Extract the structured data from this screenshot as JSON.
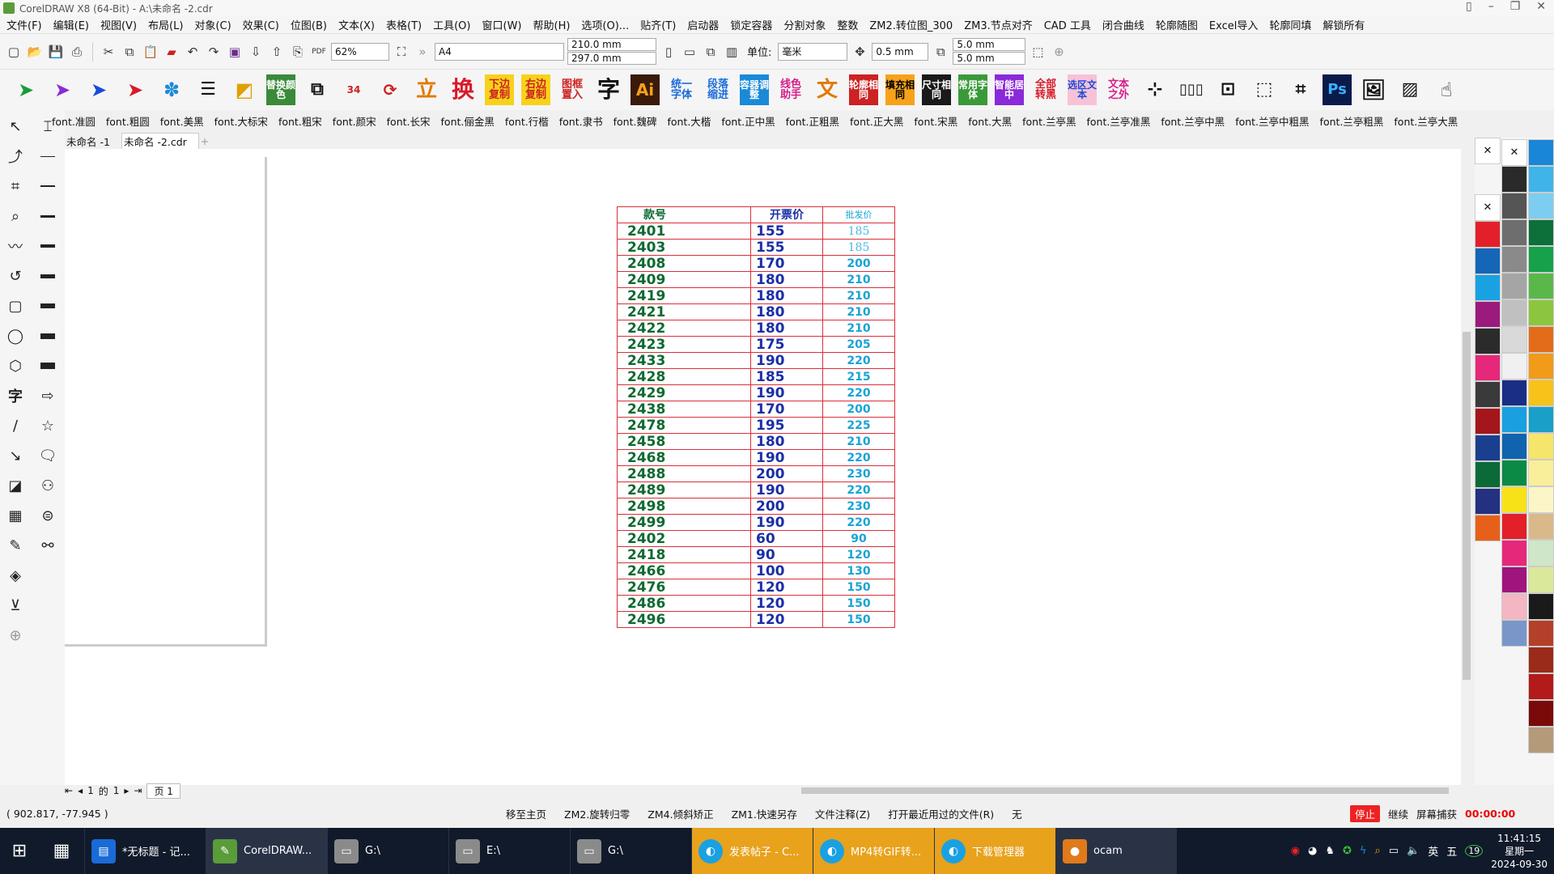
{
  "window": {
    "title": "CorelDRAW X8 (64-Bit) - A:\\未命名 -2.cdr"
  },
  "menu": [
    "文件(F)",
    "编辑(E)",
    "视图(V)",
    "布局(L)",
    "对象(C)",
    "效果(C)",
    "位图(B)",
    "文本(X)",
    "表格(T)",
    "工具(O)",
    "窗口(W)",
    "帮助(H)",
    "选项(O)...",
    "贴齐(T)",
    "启动器",
    "锁定容器",
    "分割对象",
    "整数",
    "ZM2.转位图_300",
    "ZM3.节点对齐",
    "CAD 工具",
    "闭合曲线",
    "轮廓随图",
    "Excel导入",
    "轮廓同填",
    "解锁所有"
  ],
  "toolbar": {
    "zoom": "62%",
    "page_size": "A4",
    "width": "210.0 mm",
    "height": "297.0 mm",
    "unit_label": "单位:",
    "unit": "毫米",
    "nudge": "0.5 mm",
    "dup_x": "5.0 mm",
    "dup_y": "5.0 mm"
  },
  "plugins": [
    "替换颜色",
    "换",
    "下边复制",
    "右边复制",
    "图框置入",
    "字",
    "Ai",
    "统一字体",
    "段落缩进",
    "容器调整",
    "线色助手",
    "文",
    "轮廓相同",
    "填充相同",
    "尺寸相同",
    "常用字体",
    "智能居中",
    "全部转黑",
    "选区文本",
    "文本之外",
    "Ps"
  ],
  "fonts": [
    "font.准圆",
    "font.粗圆",
    "font.美黑",
    "font.大标宋",
    "font.粗宋",
    "font.颜宋",
    "font.长宋",
    "font.俪金黑",
    "font.行楷",
    "font.隶书",
    "font.魏碑",
    "font.大楷",
    "font.正中黑",
    "font.正粗黑",
    "font.正大黑",
    "font.宋黑",
    "font.大黑",
    "font.兰亭黑",
    "font.兰亭准黑",
    "font.兰亭中黑",
    "font.兰亭中粗黑",
    "font.兰亭粗黑",
    "font.兰亭大黑"
  ],
  "tabs": [
    "未命名 -1",
    "未命名 -2.cdr"
  ],
  "price_table": {
    "headers": [
      "款号",
      "开票价",
      "批发价"
    ],
    "rows": [
      [
        "2401",
        "155",
        "185"
      ],
      [
        "2403",
        "155",
        "185"
      ],
      [
        "2408",
        "170",
        "200"
      ],
      [
        "2409",
        "180",
        "210"
      ],
      [
        "2419",
        "180",
        "210"
      ],
      [
        "2421",
        "180",
        "210"
      ],
      [
        "2422",
        "180",
        "210"
      ],
      [
        "2423",
        "175",
        "205"
      ],
      [
        "2433",
        "190",
        "220"
      ],
      [
        "2428",
        "185",
        "215"
      ],
      [
        "2429",
        "190",
        "220"
      ],
      [
        "2438",
        "170",
        "200"
      ],
      [
        "2478",
        "195",
        "225"
      ],
      [
        "2458",
        "180",
        "210"
      ],
      [
        "2468",
        "190",
        "220"
      ],
      [
        "2488",
        "200",
        "230"
      ],
      [
        "2489",
        "190",
        "220"
      ],
      [
        "2498",
        "200",
        "230"
      ],
      [
        "2499",
        "190",
        "220"
      ],
      [
        "2402",
        "60",
        "90"
      ],
      [
        "2418",
        "90",
        "120"
      ],
      [
        "2466",
        "100",
        "130"
      ],
      [
        "2476",
        "120",
        "150"
      ],
      [
        "2486",
        "120",
        "150"
      ],
      [
        "2496",
        "120",
        "150"
      ]
    ]
  },
  "page_nav": {
    "current": "1",
    "of_label": "的",
    "total": "1",
    "page_tab": "页 1"
  },
  "palette": {
    "col1": [
      "#e3202a",
      "#1566b7",
      "#1aa1e2",
      "#9b1a7e",
      "#2b2b2b",
      "#e6287a",
      "#3a3a3a",
      "#a4161b",
      "#1a3f8e",
      "#0b6a37",
      "#243080",
      "#e6601a"
    ],
    "col2": [
      "#2a2a2a",
      "#555555",
      "#6e6e6e",
      "#8a8a8a",
      "#a5a5a5",
      "#c0c0c0",
      "#d9d9d9",
      "#f0f0f0",
      "#1a2e85",
      "#1aa0e0",
      "#1163ad",
      "#0a8a44",
      "#f7e21a",
      "#e3202a",
      "#e6287a",
      "#a0147e",
      "#f4b6c2",
      "#7a96c8"
    ],
    "col3": [
      "#1a86d8",
      "#3fb4e8",
      "#7ccdf0",
      "#0d6f3a",
      "#16a14a",
      "#5ab84a",
      "#8cc63f",
      "#e36c1a",
      "#f29a1a",
      "#f7c21a",
      "#1a9fc8",
      "#f5e56a",
      "#f9ef9a",
      "#fbf5c8",
      "#d9b98a",
      "#cfe6c8",
      "#d9e89a",
      "#1a1a1a",
      "#b5402a",
      "#9a2a1a",
      "#b31a1a",
      "#7a0a0a",
      "#b59a7a"
    ]
  },
  "status": {
    "coords": "( 902.817, -77.945 )",
    "items": [
      "移至主页",
      "ZM2.旋转归零",
      "ZM4.倾斜矫正",
      "ZM1.快速另存",
      "文件注释(Z)",
      "打开最近用过的文件(R)",
      "无"
    ],
    "rec_stop": "停止",
    "rec_continue": "继续",
    "rec_capture": "屏幕捕获",
    "rec_timer": "00:00:00"
  },
  "taskbar": {
    "apps": [
      "*无标题 - 记...",
      "CorelDRAW...",
      "G:\\",
      "E:\\",
      "G:\\",
      "发表帖子 - C...",
      "MP4转GIF转...",
      "下载管理器",
      "ocam"
    ],
    "ime": "英",
    "ime2": "五",
    "badge": "19",
    "time": "11:41:15",
    "weekday": "星期一",
    "date": "2024-09-30"
  }
}
